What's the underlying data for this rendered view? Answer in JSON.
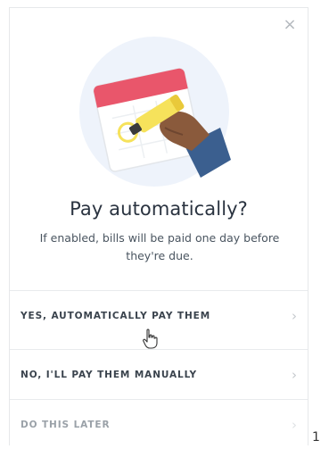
{
  "dialog": {
    "close_icon": "close-icon",
    "illustration": "calendar-hand-highlighter-illustration",
    "title": "Pay automatically?",
    "description": "If enabled, bills will be paid one day before they're due.",
    "options": [
      {
        "label": "YES, AUTOMATICALLY PAY THEM",
        "icon": "chevron-right-icon"
      },
      {
        "label": "NO, I'LL PAY THEM MANUALLY",
        "icon": "chevron-right-icon"
      },
      {
        "label": "DO THIS LATER",
        "icon": "chevron-right-icon"
      }
    ]
  },
  "edge_text": "1",
  "colors": {
    "circle_bg": "#eef3fb",
    "calendar_red": "#e9566b",
    "highlighter_yellow": "#f6e25b",
    "skin": "#8a5a3c",
    "sleeve": "#3b5f8f"
  }
}
